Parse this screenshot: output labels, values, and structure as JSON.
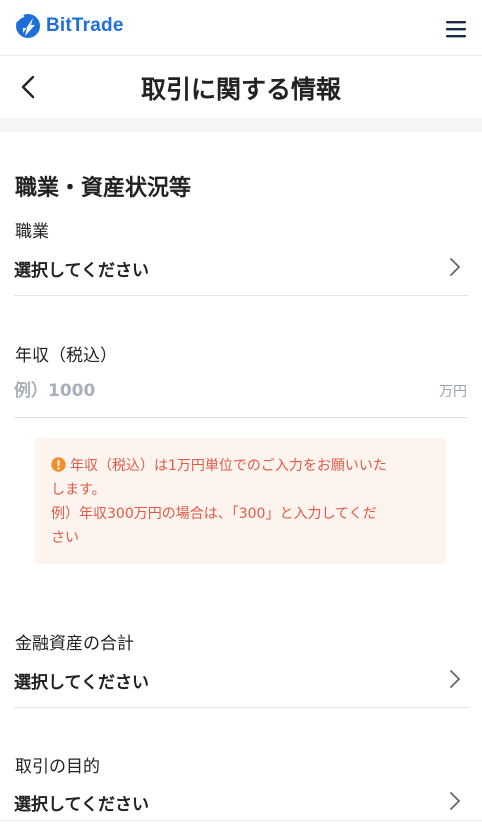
{
  "header": {
    "brand": "BitTrade",
    "brand_color": "#1e6fd9",
    "menu_icon": "hamburger-menu-icon"
  },
  "title_bar": {
    "title": "取引に関する情報",
    "back_icon": "chevron-left-icon"
  },
  "section": {
    "title": "職業・資産状況等"
  },
  "fields": {
    "occupation": {
      "label": "職業",
      "value": "選択してください"
    },
    "annual_income": {
      "label": "年収（税込）",
      "placeholder": "例）1000",
      "value": "",
      "unit": "万円"
    },
    "financial_assets": {
      "label": "金融資産の合計",
      "value": "選択してください"
    },
    "purpose": {
      "label": "取引の目的",
      "value": "選択してください"
    }
  },
  "notice": {
    "lines": [
      "年収（税込）は1万円単位でのご入力をお願いいた",
      "します。",
      "例）年収300万円の場合は、「300」と入力してくだ",
      "さい"
    ],
    "color": "#e15a45",
    "background": "#fdf3ef"
  }
}
